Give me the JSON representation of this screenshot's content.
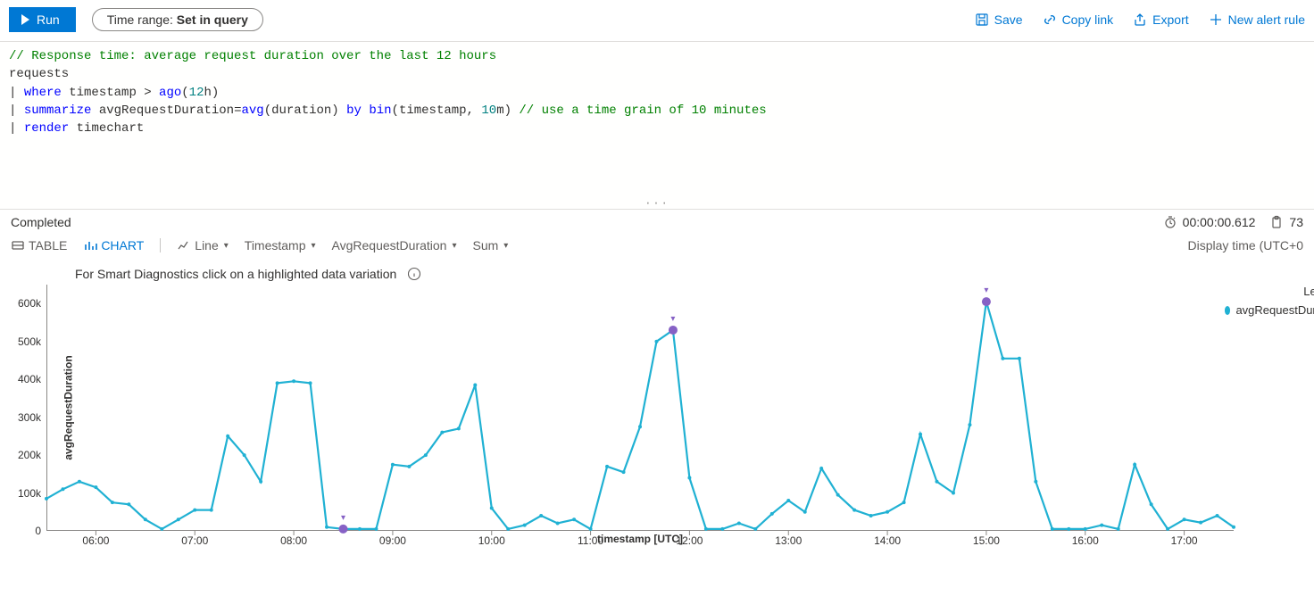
{
  "toolbar": {
    "run": "Run",
    "time_prefix": "Time range: ",
    "time_value": "Set in query",
    "save": "Save",
    "copy": "Copy link",
    "export": "Export",
    "alert": "New alert rule"
  },
  "query": {
    "line1_comment": "// Response time: average request duration over the last 12 hours",
    "line2": "requests",
    "line3_kw": "where",
    "line3_rest1": " timestamp > ",
    "line3_func": "ago",
    "line3_paren_open": "(",
    "line3_num": "12",
    "line3_unit": "h",
    "line3_paren_close": ")",
    "line4_kw": "summarize",
    "line4_rest1": " avgRequestDuration=",
    "line4_func1": "avg",
    "line4_rest2": "(duration) ",
    "line4_by": "by",
    "line4_rest3": " ",
    "line4_func2": "bin",
    "line4_rest4": "(timestamp, ",
    "line4_num": "10",
    "line4_rest5": "m) ",
    "line4_comment": "// use a time grain of 10 minutes",
    "line5_kw": "render",
    "line5_rest": " timechart"
  },
  "status": {
    "label": "Completed",
    "elapsed": "00:00:00.612",
    "rows": "73"
  },
  "viewbar": {
    "table": "TABLE",
    "chart": "CHART",
    "line": "Line",
    "ts": "Timestamp",
    "measure": "AvgRequestDuration",
    "agg": "Sum",
    "display": "Display time (UTC+0"
  },
  "hint": "For Smart Diagnostics click on a highlighted data variation",
  "legend": {
    "title": "Leg",
    "series": "avgRequestDura"
  },
  "chart_data": {
    "type": "line",
    "title": "",
    "xlabel": "timestamp [UTC]",
    "ylabel": "avgRequestDuration",
    "ylim": [
      0,
      650000
    ],
    "y_ticks": [
      0,
      100000,
      200000,
      300000,
      400000,
      500000,
      600000
    ],
    "y_tick_labels": [
      "0",
      "100k",
      "200k",
      "300k",
      "400k",
      "500k",
      "600k"
    ],
    "x_tick_labels": [
      "06:00",
      "07:00",
      "08:00",
      "09:00",
      "10:00",
      "11:00",
      "12:00",
      "13:00",
      "14:00",
      "15:00",
      "16:00",
      "17:00"
    ],
    "series": [
      {
        "name": "avgRequestDuration",
        "x_minutes_from_0530": [
          0,
          10,
          20,
          30,
          40,
          50,
          60,
          70,
          80,
          90,
          100,
          110,
          120,
          130,
          140,
          150,
          160,
          170,
          180,
          190,
          200,
          210,
          220,
          230,
          240,
          250,
          260,
          270,
          280,
          290,
          300,
          310,
          320,
          330,
          340,
          350,
          360,
          370,
          380,
          390,
          400,
          410,
          420,
          430,
          440,
          450,
          460,
          470,
          480,
          490,
          500,
          510,
          520,
          530,
          540,
          550,
          560,
          570,
          580,
          590,
          600,
          610,
          620,
          630,
          640,
          650,
          660,
          670,
          680,
          690,
          700,
          710,
          720
        ],
        "values": [
          85000,
          110000,
          130000,
          115000,
          75000,
          70000,
          30000,
          5000,
          30000,
          55000,
          55000,
          250000,
          200000,
          130000,
          390000,
          395000,
          390000,
          10000,
          5000,
          5000,
          5000,
          175000,
          170000,
          200000,
          260000,
          270000,
          385000,
          60000,
          5000,
          15000,
          40000,
          20000,
          30000,
          5000,
          170000,
          155000,
          275000,
          500000,
          530000,
          140000,
          5000,
          5000,
          20000,
          5000,
          45000,
          80000,
          50000,
          165000,
          95000,
          55000,
          40000,
          50000,
          75000,
          255000,
          130000,
          100000,
          280000,
          605000,
          455000,
          455000,
          130000,
          5000,
          5000,
          5000,
          15000,
          5000,
          175000,
          70000,
          5000,
          30000,
          22000,
          40000,
          10000
        ]
      }
    ],
    "highlights": [
      {
        "idx": 18,
        "value": 5000
      },
      {
        "idx": 38,
        "value": 530000
      },
      {
        "idx": 57,
        "value": 605000
      }
    ]
  }
}
